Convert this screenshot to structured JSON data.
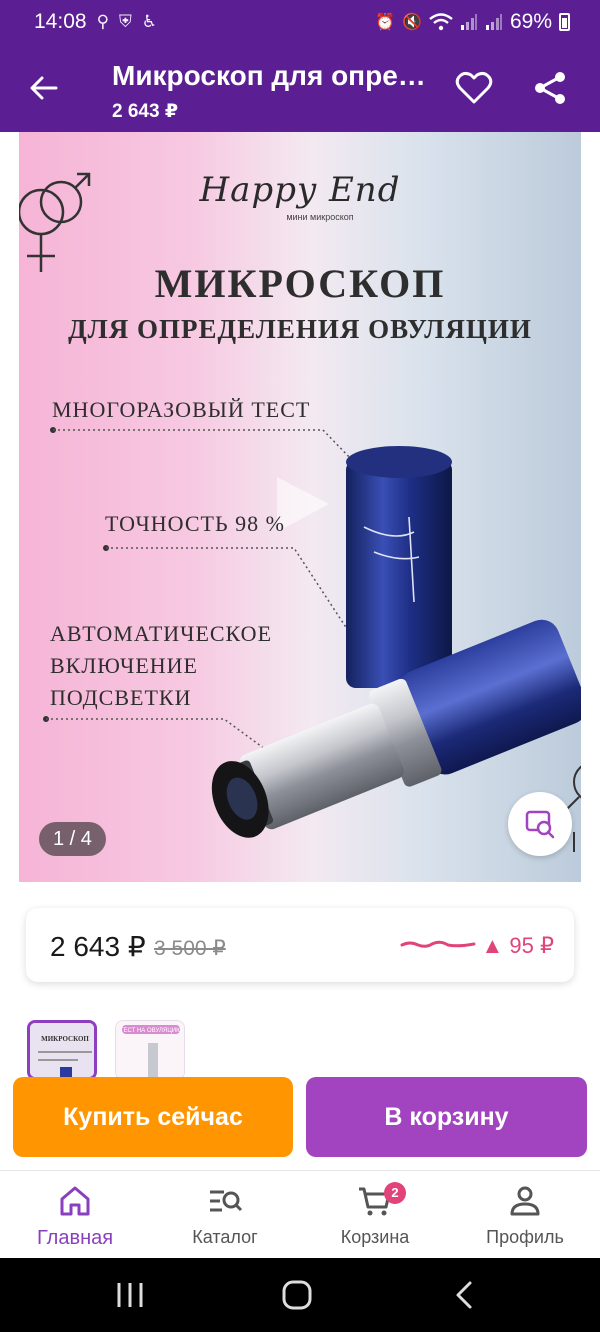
{
  "status_bar": {
    "time": "14:08",
    "battery": "69%",
    "left_icons": [
      "odnoklassniki-icon",
      "shield-icon",
      "accessibility-icon"
    ],
    "right_icons": [
      "alarm-icon",
      "mute-icon",
      "wifi-icon",
      "signal-icon",
      "signal-icon",
      "battery-icon"
    ]
  },
  "app_bar": {
    "title": "Микроскоп для определения овуляции",
    "price": "2 643 ₽",
    "icons": [
      "back-arrow-icon",
      "heart-icon",
      "share-icon"
    ]
  },
  "gallery": {
    "brand": "Happy End",
    "brand_sub": "мини микроскоп",
    "headline": "МИКРОСКОП",
    "subheadline": "ДЛЯ ОПРЕДЕЛЕНИЯ ОВУЛЯЦИИ",
    "features": [
      "МНОГОРАЗОВЫЙ ТЕСТ",
      "ТОЧНОСТЬ 98 %",
      "АВТОМАТИЧЕСКОЕ ВКЛЮЧЕНИЕ ПОДСВЕТКИ"
    ],
    "counter": "1 / 4",
    "search_icon": "image-search-icon"
  },
  "price_card": {
    "current": "2 643 ₽",
    "old": "3 500 ₽",
    "delta": "▲ 95 ₽",
    "accent_color": "#e0447a"
  },
  "thumbnails": [
    {
      "title": "МИКРОСКОП",
      "selected": true
    },
    {
      "title": "ТЕСТ НА ОВУЛЯЦИЮ",
      "selected": false
    }
  ],
  "actions": {
    "buy_now": "Купить сейчас",
    "add_to_cart": "В корзину",
    "buy_color": "#ff9500",
    "cart_color": "#a243bf"
  },
  "bottom_nav": {
    "items": [
      {
        "label": "Главная",
        "icon": "home-icon",
        "active": true
      },
      {
        "label": "Каталог",
        "icon": "catalog-search-icon",
        "active": false
      },
      {
        "label": "Корзина",
        "icon": "cart-icon",
        "active": false,
        "badge": "2"
      },
      {
        "label": "Профиль",
        "icon": "profile-icon",
        "active": false
      }
    ]
  },
  "system_nav": {
    "icons": [
      "recents-icon",
      "home-circle-icon",
      "back-chevron-icon"
    ]
  },
  "theme": {
    "primary": "#5b1f93",
    "accent": "#8a3fbe"
  }
}
